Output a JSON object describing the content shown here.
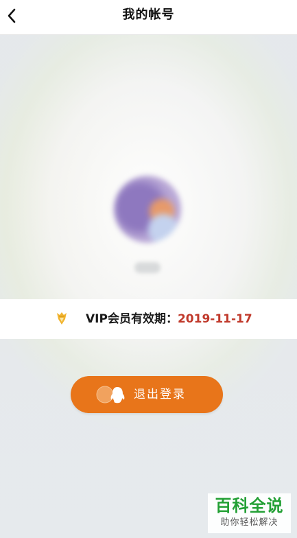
{
  "header": {
    "title": "我的帐号"
  },
  "vip": {
    "label": "VIP会员有效期：",
    "expiry": "2019-11-17"
  },
  "logout": {
    "label": "退出登录"
  },
  "watermark": {
    "main": "百科全说",
    "sub": "助你轻松解决"
  },
  "colors": {
    "accent": "#e8751a",
    "expiry_text": "#c0392b",
    "watermark": "#23a035"
  },
  "icons": {
    "back": "chevron-left-icon",
    "vip": "vip-badge-icon",
    "logout": "qq-penguin-icon"
  }
}
